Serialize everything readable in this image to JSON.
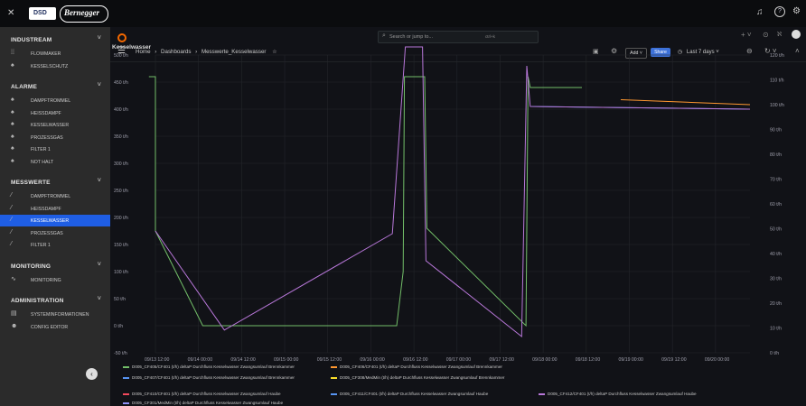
{
  "topbar": {
    "logo_left": "DSD",
    "logo_right": "Bernegger",
    "search_placeholder": "Search or jump to...",
    "search_shortcut": "ctrl+k"
  },
  "sidebar": {
    "sections": [
      {
        "title": "INDUSTREAM",
        "items": [
          {
            "label": "FLOWMAKER",
            "icon": "grid-icon"
          },
          {
            "label": "KESSELSCHUTZ",
            "icon": "bell-icon"
          }
        ]
      },
      {
        "title": "ALARME",
        "items": [
          {
            "label": "DAMPFTROMMEL",
            "icon": "bell-icon"
          },
          {
            "label": "HEISSDAMPF",
            "icon": "bell-icon"
          },
          {
            "label": "KESSELWASSER",
            "icon": "bell-icon"
          },
          {
            "label": "PROZESSGAS",
            "icon": "bell-icon"
          },
          {
            "label": "FILTER 1",
            "icon": "bell-icon"
          },
          {
            "label": "NOT HALT",
            "icon": "bell-icon"
          }
        ]
      },
      {
        "title": "MESSWERTE",
        "items": [
          {
            "label": "DAMPFTROMMEL",
            "icon": "chart-icon"
          },
          {
            "label": "HEISSDAMPF",
            "icon": "chart-icon"
          },
          {
            "label": "KESSELWASSER",
            "icon": "chart-icon",
            "active": true
          },
          {
            "label": "PROZESSGAS",
            "icon": "chart-icon"
          },
          {
            "label": "FILTER 1",
            "icon": "chart-icon"
          }
        ]
      },
      {
        "title": "MONITORING",
        "items": [
          {
            "label": "MONITORING",
            "icon": "pulse-icon"
          }
        ]
      },
      {
        "title": "ADMINISTRATION",
        "items": [
          {
            "label": "SYSTEMINFORMATIONEN",
            "icon": "server-icon"
          },
          {
            "label": "CONFIG EDITOR",
            "icon": "users-icon"
          }
        ]
      }
    ]
  },
  "breadcrumb": {
    "home": "Home",
    "sep": "›",
    "dashboards": "Dashboards",
    "current": "Messwerte_Kesselwasser"
  },
  "toolbar": {
    "add": "Add",
    "share": "Share",
    "time_range": "Last 7 days"
  },
  "panel": {
    "title": "Kesselwasser"
  },
  "chart_data": {
    "type": "line",
    "y_left_ticks": [
      "500 t/h",
      "450 t/h",
      "400 t/h",
      "350 t/h",
      "300 t/h",
      "250 t/h",
      "200 t/h",
      "150 t/h",
      "100 t/h",
      "50 t/h",
      "0 t/h",
      "-50 t/h"
    ],
    "y_left_range": [
      -50,
      500
    ],
    "y_right_ticks": [
      "120 t/h",
      "110 t/h",
      "100 t/h",
      "90 t/h",
      "80 t/h",
      "70 t/h",
      "60 t/h",
      "50 t/h",
      "40 t/h",
      "30 t/h",
      "20 t/h",
      "10 t/h",
      "0 t/h"
    ],
    "y_right_range": [
      0,
      120
    ],
    "x_ticks": [
      "09/13 12:00",
      "09/14 00:00",
      "09/14 12:00",
      "09/15 00:00",
      "09/15 12:00",
      "09/16 00:00",
      "09/16 12:00",
      "09/17 00:00",
      "09/17 12:00",
      "09/18 00:00",
      "09/18 12:00",
      "09/19 00:00",
      "09/19 12:00",
      "09/20 00:00"
    ],
    "x_range": [
      0,
      13.8
    ],
    "series": [
      {
        "name": "D005_CF405/CF401 (t/h) deltaP Durchfluss Kesselwasser Zwangsumlauf Brennkammer",
        "color": "#73bf69",
        "axis": "left",
        "points": [
          [
            -0.15,
            460
          ],
          [
            0,
            460
          ],
          [
            0,
            175
          ],
          [
            1.1,
            0
          ],
          [
            5.6,
            0
          ],
          [
            5.75,
            100
          ],
          [
            5.78,
            460
          ],
          [
            6.25,
            460
          ],
          [
            6.3,
            180
          ],
          [
            8.6,
            0
          ],
          [
            8.65,
            460
          ],
          [
            8.7,
            440
          ],
          [
            9.9,
            440
          ]
        ]
      },
      {
        "name": "D005_CF406/CF401 (t/h) deltaP Durchfluss Kesselwasser Zwangsumlauf Brennkammer",
        "color": "#ff9830",
        "axis": "right",
        "points": [
          [
            10.8,
            102
          ],
          [
            13.8,
            100
          ]
        ]
      },
      {
        "name": "D005_CF407/CF401 (t/h) deltaP Durchfluss Kesselwasser Zwangsumlauf Brennkammer",
        "color": "#5794f2",
        "axis": "left",
        "points": [
          [
            8.72,
            405
          ],
          [
            13.8,
            400
          ]
        ]
      },
      {
        "name": "D005_CF308/MedMin (t/h) deltaP Durchfluss Kesselwasser Zwangsumlauf Brennkammer",
        "color": "#fade2a",
        "axis": "left",
        "points": []
      },
      {
        "name": "D005_CF410/CF401 (t/h) deltaP Durchfluss Kesselwasser Zwangsumlauf Haube",
        "color": "#f2495c",
        "axis": "left",
        "points": []
      },
      {
        "name": "D005_CF411/CF401 (t/h) deltaP Durchfluss Kesselwasser Zwangsumlauf Haube",
        "color": "#5794f2",
        "axis": "left",
        "points": []
      },
      {
        "name": "D005_CF412/CF401 (t/h) deltaP Durchfluss Kesselwasser Zwangsumlauf Haube",
        "color": "#b877d9",
        "axis": "left",
        "points": [
          [
            0,
            175
          ],
          [
            1.6,
            -8
          ],
          [
            5.5,
            170
          ],
          [
            5.8,
            515
          ],
          [
            6.2,
            515
          ],
          [
            6.28,
            120
          ],
          [
            8.5,
            -20
          ],
          [
            8.62,
            480
          ],
          [
            8.7,
            405
          ],
          [
            13.8,
            400
          ]
        ]
      },
      {
        "name": "D005_CF301/MedMin (t/h) deltaP Durchfluss Kesselwasser Zwangsumlauf Haube",
        "color": "#8f8ff6",
        "axis": "left",
        "points": []
      }
    ],
    "legend_placement": "bottom"
  }
}
